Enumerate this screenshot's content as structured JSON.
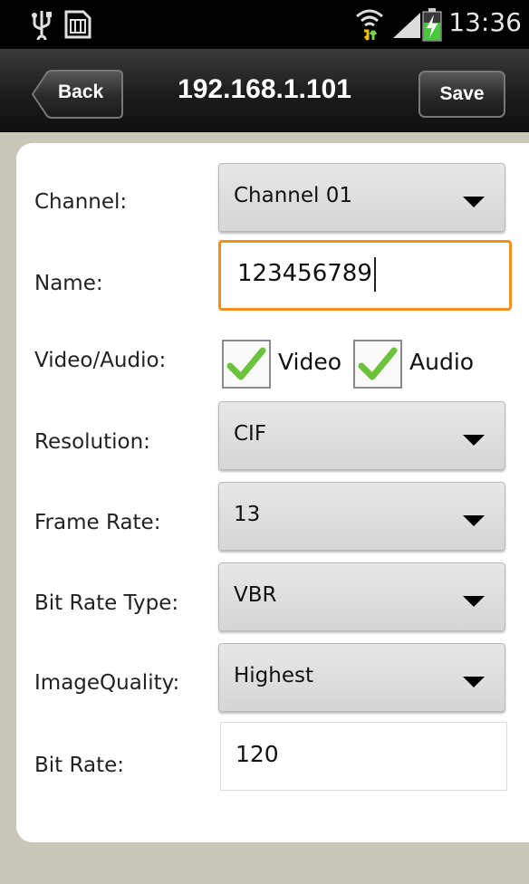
{
  "status_bar": {
    "time": "13:36",
    "icons": [
      "usb-icon",
      "sim-card-icon",
      "wifi-icon",
      "signal-icon",
      "battery-charging-icon"
    ]
  },
  "action_bar": {
    "back_label": "Back",
    "title": "192.168.1.101",
    "save_label": "Save"
  },
  "form": {
    "channel": {
      "label": "Channel:",
      "value": "Channel 01"
    },
    "name": {
      "label": "Name:",
      "value": "123456789"
    },
    "video_audio": {
      "label": "Video/Audio:",
      "video_label": "Video",
      "video_checked": true,
      "audio_label": "Audio",
      "audio_checked": true
    },
    "resolution": {
      "label": "Resolution:",
      "value": "CIF"
    },
    "frame_rate": {
      "label": "Frame Rate:",
      "value": "13"
    },
    "bit_rate_type": {
      "label": "Bit Rate Type:",
      "value": "VBR"
    },
    "image_quality": {
      "label": "ImageQuality:",
      "value": "Highest"
    },
    "bit_rate": {
      "label": "Bit Rate:",
      "value": "120"
    }
  },
  "colors": {
    "focus_border": "#f0901d",
    "check_green": "#6cc23a",
    "background": "#c9c7b7"
  }
}
